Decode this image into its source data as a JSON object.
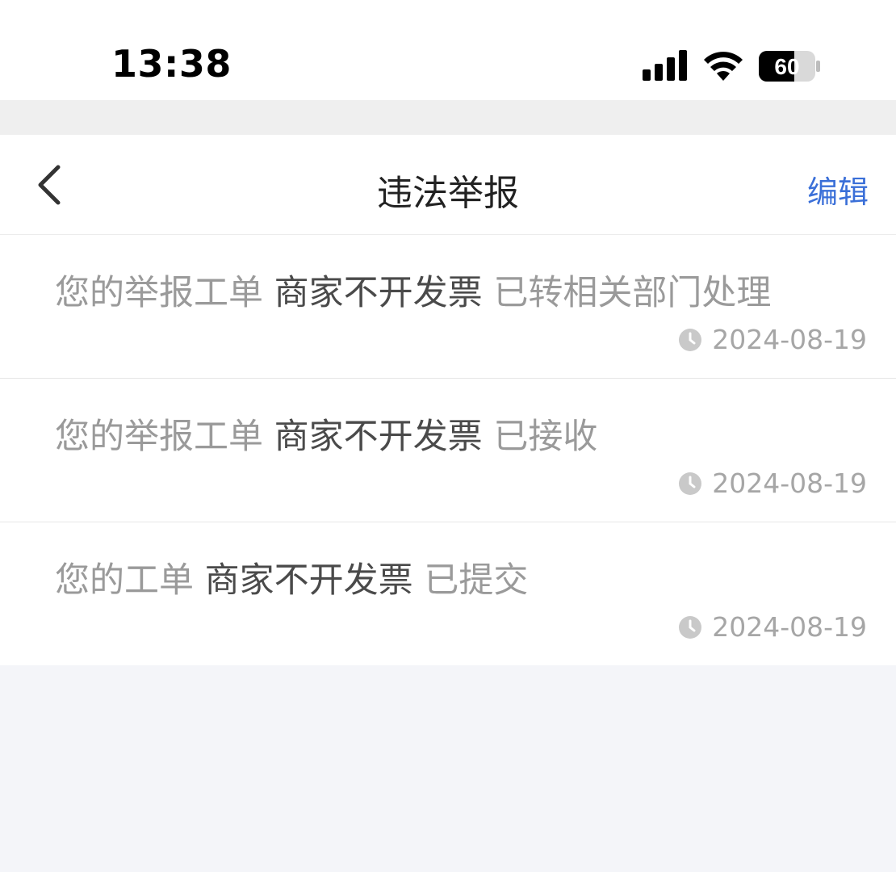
{
  "status_bar": {
    "time": "13:38",
    "battery": "60",
    "icons": [
      "signal-icon",
      "wifi-icon",
      "battery-icon"
    ]
  },
  "nav": {
    "back_icon": "chevron-left-icon",
    "title": "违法举报",
    "edit_label": "编辑"
  },
  "colors": {
    "accent": "#3a6fd8",
    "muted_text": "#9a9a9a",
    "emphasis_text": "#4a4a4a",
    "background": "#f4f5f9"
  },
  "items": [
    {
      "prefix": "您的举报工单 ",
      "subject": "商家不开发票",
      "suffix": " 已转相关部门处理",
      "date": "2024-08-19"
    },
    {
      "prefix": "您的举报工单 ",
      "subject": "商家不开发票",
      "suffix": " 已接收",
      "date": "2024-08-19"
    },
    {
      "prefix": "您的工单 ",
      "subject": "商家不开发票",
      "suffix": " 已提交",
      "date": "2024-08-19"
    }
  ]
}
